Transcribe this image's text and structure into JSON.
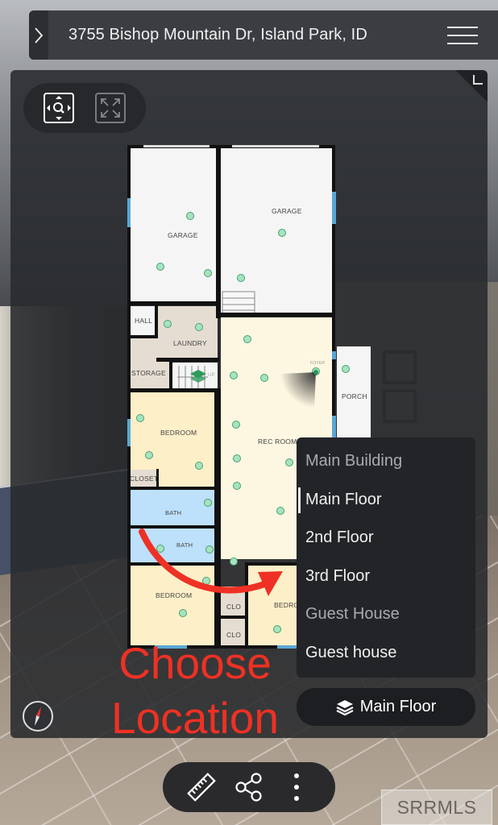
{
  "header": {
    "title": "3755 Bishop Mountain Dr, Island Park, ID",
    "toggle_icon": "chevron-right-icon",
    "menu_icon": "hamburger-menu-icon"
  },
  "view_controls": {
    "navigate_icon": "navigate-zoom-icon",
    "fullscreen_icon": "fullscreen-icon"
  },
  "floorplan": {
    "rooms": [
      {
        "name": "GARAGE",
        "id": "garage-left"
      },
      {
        "name": "GARAGE",
        "id": "garage-right"
      },
      {
        "name": "HALL",
        "id": "hall"
      },
      {
        "name": "LAUNDRY",
        "id": "laundry"
      },
      {
        "name": "STORAGE",
        "id": "storage"
      },
      {
        "name": "FOYER",
        "id": "foyer"
      },
      {
        "name": "PORCH",
        "id": "porch"
      },
      {
        "name": "BEDROOM",
        "id": "bedroom-1"
      },
      {
        "name": "REC ROOM",
        "id": "rec-room"
      },
      {
        "name": "CLOSET",
        "id": "closet"
      },
      {
        "name": "BATH",
        "id": "bath-1"
      },
      {
        "name": "BATH",
        "id": "bath-2"
      },
      {
        "name": "BEDROOM",
        "id": "bedroom-2"
      },
      {
        "name": "CLO",
        "id": "clo-1"
      },
      {
        "name": "CLO",
        "id": "clo-2"
      },
      {
        "name": "BEDROOM",
        "id": "bedroom-3"
      }
    ],
    "stairs_label": "UP",
    "colors": {
      "garage": "#f5f5f5",
      "utility": "#e5ddd2",
      "living": "#fdf6e0",
      "bedroom": "#fdefc8",
      "bath": "#bde0fb",
      "wall": "#111111",
      "window": "#5aa7d6",
      "hotspot": "#a6e3c0"
    }
  },
  "floor_menu": {
    "items": [
      {
        "label": "Main Building",
        "type": "group"
      },
      {
        "label": "Main Floor",
        "type": "floor",
        "selected": true
      },
      {
        "label": "2nd Floor",
        "type": "floor"
      },
      {
        "label": "3rd Floor",
        "type": "floor"
      },
      {
        "label": "Guest House",
        "type": "group"
      },
      {
        "label": "Guest house",
        "type": "floor"
      }
    ]
  },
  "floor_button": {
    "label": "Main Floor",
    "icon": "layers-icon"
  },
  "annotation": {
    "line1": "Choose",
    "line2": "Location",
    "color": "#ee3124"
  },
  "toolbar": {
    "measure_icon": "ruler-icon",
    "share_icon": "share-icon",
    "more_icon": "more-vertical-icon"
  },
  "compass_icon": "compass-icon",
  "watermark": "SRRMLS"
}
